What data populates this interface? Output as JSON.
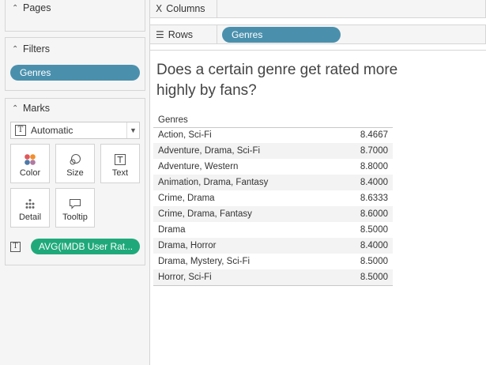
{
  "panes": {
    "pages": "Pages",
    "filters": "Filters",
    "filter_pill": "Genres",
    "marks": "Marks"
  },
  "marks": {
    "type": "Automatic",
    "buttons": {
      "color": "Color",
      "size": "Size",
      "text": "Text",
      "detail": "Detail",
      "tooltip": "Tooltip"
    },
    "text_field": "AVG(IMDB User Rat..."
  },
  "shelves": {
    "columns": "Columns",
    "rows": "Rows",
    "rows_pill": "Genres"
  },
  "view": {
    "title": "Does a certain genre get rated more highly by fans?",
    "column_header": "Genres"
  },
  "chart_data": {
    "type": "table",
    "columns": [
      "Genres",
      "AVG(IMDB User Rating)"
    ],
    "rows": [
      [
        "Action, Sci-Fi",
        "8.4667"
      ],
      [
        "Adventure, Drama, Sci-Fi",
        "8.7000"
      ],
      [
        "Adventure, Western",
        "8.8000"
      ],
      [
        "Animation, Drama, Fantasy",
        "8.4000"
      ],
      [
        "Crime, Drama",
        "8.6333"
      ],
      [
        "Crime, Drama, Fantasy",
        "8.6000"
      ],
      [
        "Drama",
        "8.5000"
      ],
      [
        "Drama, Horror",
        "8.4000"
      ],
      [
        "Drama, Mystery, Sci-Fi",
        "8.5000"
      ],
      [
        "Horror, Sci-Fi",
        "8.5000"
      ]
    ]
  },
  "colors": {
    "dimension_pill": "#4a90ad",
    "measure_pill": "#1fa97a",
    "panel_bg": "#f5f5f5",
    "band_row": "#f3f3f3"
  },
  "icons": {
    "columns": "columns-icon",
    "rows": "rows-icon",
    "color": "color-dots-icon",
    "size": "size-circles-icon",
    "text": "text-t-icon",
    "detail": "detail-dots-icon",
    "tooltip": "tooltip-bubble-icon"
  }
}
